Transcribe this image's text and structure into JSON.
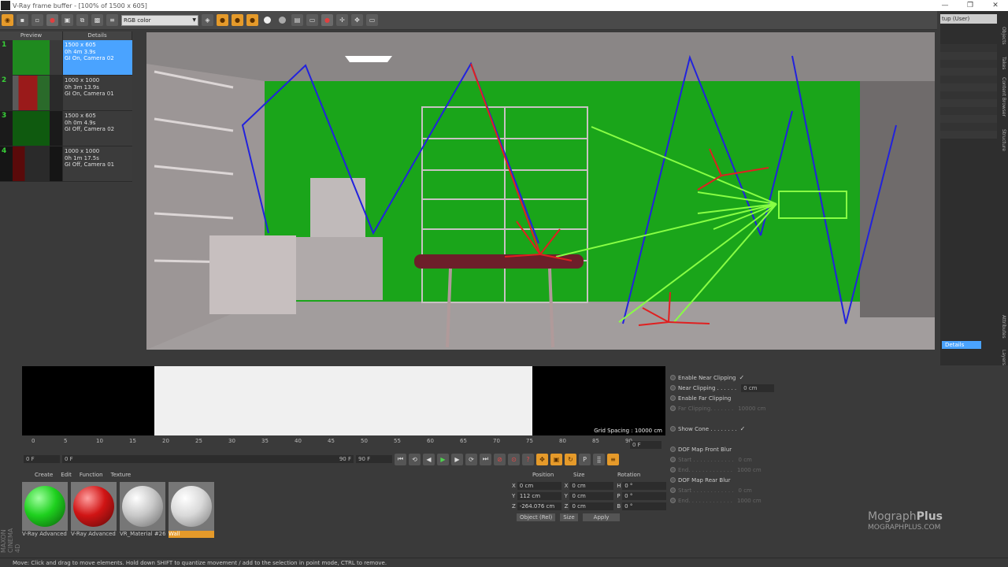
{
  "window": {
    "title": "V-Ray frame buffer - [100% of 1500 x 605]",
    "right_layout": "tup (User)"
  },
  "toolbar": {
    "channel_select": "RGB color"
  },
  "history": {
    "tabs": [
      "Preview",
      "Details"
    ],
    "items": [
      {
        "num": "1",
        "line1": "1500 x 605",
        "line2": "0h 4m 3.9s",
        "line3": "GI On, Camera 02",
        "selected": true,
        "thumb_color": "#1f8a1f"
      },
      {
        "num": "2",
        "line1": "1000 x 1000",
        "line2": "0h 3m 13.9s",
        "line3": "GI On, Camera 01",
        "selected": false,
        "thumb_color": "#9a1a1a"
      },
      {
        "num": "3",
        "line1": "1500 x 605",
        "line2": "0h 0m 4.9s",
        "line3": "GI Off, Camera 02",
        "selected": false,
        "thumb_color": "#0f5a0f"
      },
      {
        "num": "4",
        "line1": "1000 x 1000",
        "line2": "0h 1m 17.5s",
        "line3": "GI Off, Camera 01",
        "selected": false,
        "thumb_color": "#5a0a0a"
      }
    ]
  },
  "right_panel": {
    "details_button": "Details",
    "vertical_tabs": [
      "Objects",
      "Takes",
      "Content Browser",
      "Structure",
      "Attributes",
      "Layers"
    ]
  },
  "mini_viewport": {
    "grid_spacing": "Grid Spacing : 10000 cm"
  },
  "timeline": {
    "ticks": [
      "0",
      "5",
      "10",
      "15",
      "20",
      "25",
      "30",
      "35",
      "40",
      "45",
      "50",
      "55",
      "60",
      "65",
      "70",
      "75",
      "80",
      "85",
      "90"
    ],
    "current_frame": "0 F",
    "start_field": "0 F",
    "range_start": "0 F",
    "range_end": "90 F",
    "end_field": "90 F",
    "frame_label": "0 F"
  },
  "materials": {
    "menu": [
      "Create",
      "Edit",
      "Function",
      "Texture"
    ],
    "items": [
      {
        "label": "V-Ray Advanced",
        "color": "#1ed01e",
        "selected": false
      },
      {
        "label": "V-Ray Advanced",
        "color": "#d01414",
        "selected": false
      },
      {
        "label": "VR_Material #26",
        "color": "#c8c8c8",
        "selected": false
      },
      {
        "label": "Wall",
        "color": "#d9d9d9",
        "selected": true
      }
    ]
  },
  "coordinates": {
    "headers": [
      "Position",
      "Size",
      "Rotation"
    ],
    "rows": [
      {
        "a1": "X",
        "v1": "0 cm",
        "a2": "X",
        "v2": "0 cm",
        "a3": "H",
        "v3": "0 °"
      },
      {
        "a1": "Y",
        "v1": "112 cm",
        "a2": "Y",
        "v2": "0 cm",
        "a3": "P",
        "v3": "0 °"
      },
      {
        "a1": "Z",
        "v1": "-264.076 cm",
        "a2": "Z",
        "v2": "0 cm",
        "a3": "B",
        "v3": "0 °"
      }
    ],
    "mode_select": "Object (Rel)",
    "size_select": "Size",
    "apply_button": "Apply"
  },
  "attributes": {
    "rows": [
      {
        "label": "Enable Near Clipping",
        "value": "✓",
        "dim": false
      },
      {
        "label": "Near Clipping . . . . . .",
        "value": "0 cm",
        "dim": false
      },
      {
        "label": "Enable Far Clipping",
        "value": "",
        "dim": false
      },
      {
        "label": "Far Clipping. . . . . . .",
        "value": "10000 cm",
        "dim": true
      },
      {
        "label": "",
        "value": "",
        "dim": false
      },
      {
        "label": "Show Cone . . . . . . . .",
        "value": "✓",
        "dim": false
      },
      {
        "label": "",
        "value": "",
        "dim": false
      },
      {
        "label": "DOF Map Front Blur",
        "value": "",
        "dim": false
      },
      {
        "label": "Start . . . . . . . . . . . .",
        "value": "0 cm",
        "dim": true
      },
      {
        "label": "End. . . . . . . . . . . . .",
        "value": "1000 cm",
        "dim": true
      },
      {
        "label": "DOF Map Rear Blur",
        "value": "",
        "dim": false
      },
      {
        "label": "Start . . . . . . . . . . . .",
        "value": "0 cm",
        "dim": true
      },
      {
        "label": "End. . . . . . . . . . . . .",
        "value": "1000 cm",
        "dim": true
      }
    ]
  },
  "brand": {
    "name_a": "Mograph",
    "name_b": "Plus",
    "url": "MOGRAPHPLUS.COM"
  },
  "maxon": "MAXON CINEMA 4D",
  "status": "Move: Click and drag to move elements. Hold down SHIFT to quantize movement / add to the selection in point mode, CTRL to remove."
}
